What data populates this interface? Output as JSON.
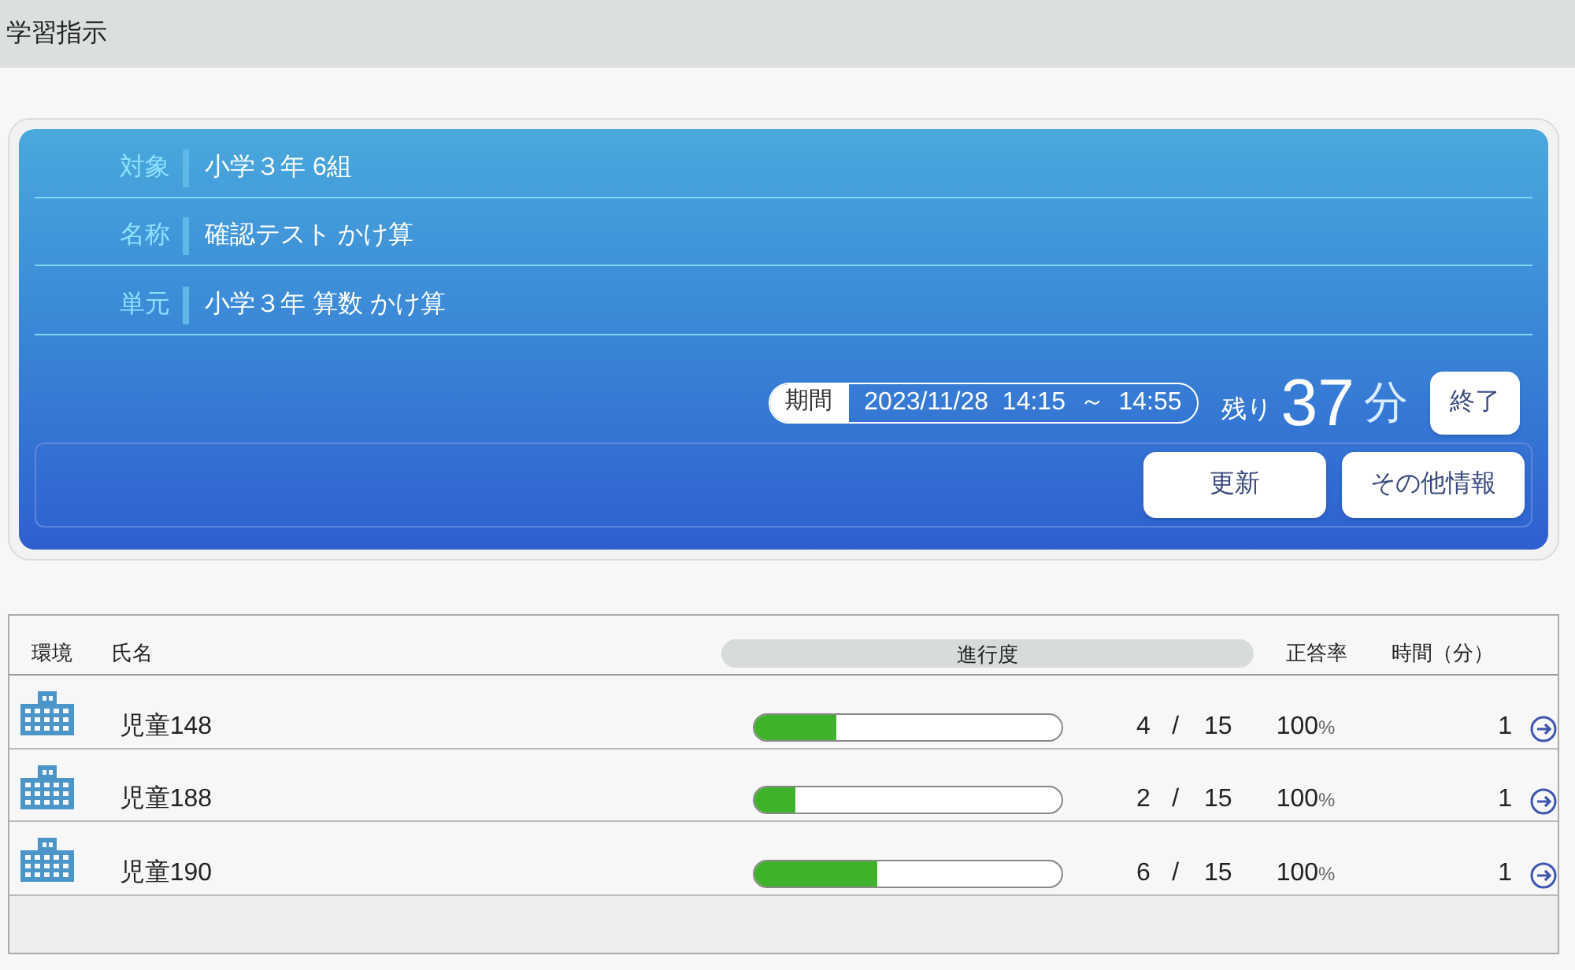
{
  "page_title": "学習指示",
  "info": {
    "rows": [
      {
        "label": "対象",
        "value": "小学３年  6組"
      },
      {
        "label": "名称",
        "value": "確認テスト かけ算"
      },
      {
        "label": "単元",
        "value": "小学３年  算数  かけ算"
      }
    ],
    "period_label": "期間",
    "period_value": "2023/11/28  14:15  ～  14:55",
    "remaining_label": "残り",
    "remaining_value": "37",
    "remaining_unit": "分",
    "end_button": "終了",
    "buttons": [
      "更新",
      "その他情報"
    ]
  },
  "table": {
    "columns": [
      "環境",
      "氏名",
      "進行度",
      "正答率",
      "時間（分）"
    ],
    "rows": [
      {
        "name": "児童148",
        "level": 0.267,
        "done": "4",
        "sep": "/",
        "total": "15",
        "rate": "100",
        "rate_unit": "%",
        "time": "1"
      },
      {
        "name": "児童188",
        "level": 0.133,
        "done": "2",
        "sep": "/",
        "total": "15",
        "rate": "100",
        "rate_unit": "%",
        "time": "1"
      },
      {
        "name": "児童190",
        "level": 0.4,
        "done": "6",
        "sep": "/",
        "total": "15",
        "rate": "100",
        "rate_unit": "%",
        "time": "1"
      }
    ]
  }
}
